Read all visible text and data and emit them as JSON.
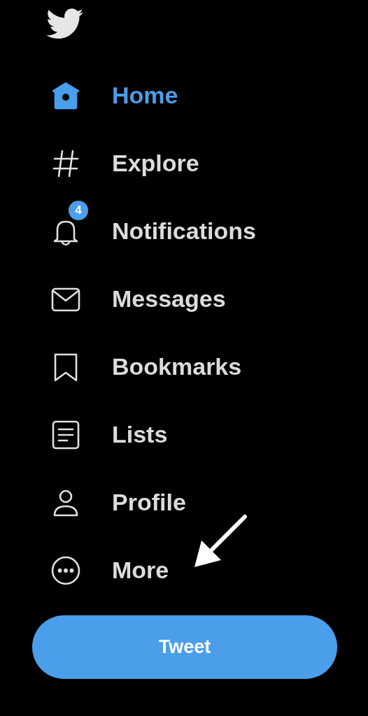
{
  "nav": {
    "items": [
      {
        "label": "Home",
        "selected": true
      },
      {
        "label": "Explore",
        "selected": false
      },
      {
        "label": "Notifications",
        "selected": false,
        "badge": "4"
      },
      {
        "label": "Messages",
        "selected": false
      },
      {
        "label": "Bookmarks",
        "selected": false
      },
      {
        "label": "Lists",
        "selected": false
      },
      {
        "label": "Profile",
        "selected": false
      },
      {
        "label": "More",
        "selected": false
      }
    ]
  },
  "tweet_button": {
    "label": "Tweet"
  }
}
